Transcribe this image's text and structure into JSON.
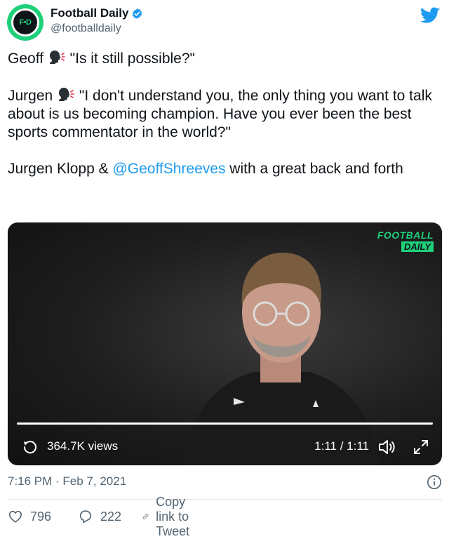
{
  "author": {
    "display_name": "Football Daily",
    "handle": "@footballdaily",
    "avatar_text": "F•D"
  },
  "tweet": {
    "line1_speaker": "Geoff",
    "line1_quote": " \"Is it still possible?\"",
    "line2_speaker": "Jurgen",
    "line2_quote": " \"I don't understand you, the only thing you want to talk about is us becoming champion. Have you ever been the best sports commentator in the world?\"",
    "line3_before": "Jurgen Klopp & ",
    "line3_mention": "@GeoffShreeves",
    "line3_after": " with a great back and forth"
  },
  "media": {
    "brand_top": "FOOTBALL",
    "brand_bottom": "DAILY",
    "views": "364.7K views",
    "time": "1:11 / 1:11",
    "progress": 1.0
  },
  "meta": {
    "timestamp": "7:16 PM · Feb 7, 2021"
  },
  "actions": {
    "likes": "796",
    "replies": "222",
    "copy_link": "Copy link to Tweet"
  },
  "colors": {
    "accent": "#1d9bf0",
    "brand_green": "#1ed07a",
    "muted": "#536471"
  },
  "icons": [
    "twitter-bird-icon",
    "verified-badge-icon",
    "speaking-head-icon",
    "replay-icon",
    "volume-icon",
    "fullscreen-icon",
    "info-icon",
    "heart-icon",
    "reply-icon",
    "link-icon"
  ]
}
